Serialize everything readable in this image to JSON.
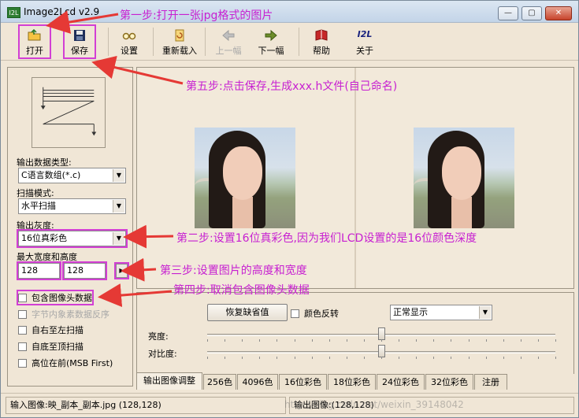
{
  "window": {
    "title": "Image2Lcd v2.9",
    "app_icon_text": "I2L"
  },
  "toolbar": {
    "items": [
      {
        "label": "打开",
        "icon": "folder-open-icon",
        "enabled": true
      },
      {
        "label": "保存",
        "icon": "floppy-disk-icon",
        "enabled": true
      },
      {
        "label": "设置",
        "icon": "glasses-icon",
        "enabled": true
      },
      {
        "label": "重新载入",
        "icon": "reload-icon",
        "enabled": true
      },
      {
        "label": "上一幅",
        "icon": "arrow-left-icon",
        "enabled": false
      },
      {
        "label": "下一幅",
        "icon": "arrow-right-icon",
        "enabled": true
      },
      {
        "label": "帮助",
        "icon": "help-book-icon",
        "enabled": true
      },
      {
        "label": "关于",
        "icon": "i2l-logo-icon",
        "enabled": true
      }
    ],
    "about_logo_text": "I2L"
  },
  "settings": {
    "output_type_label": "输出数据类型:",
    "output_type_value": "C语言数组(*.c)",
    "scan_mode_label": "扫描模式:",
    "scan_mode_value": "水平扫描",
    "gray_label": "输出灰度:",
    "gray_value": "16位真彩色",
    "size_label": "最大宽度和高度",
    "max_width": "128",
    "max_height": "128",
    "checkboxes": [
      {
        "label": "包含图像头数据",
        "checked": false,
        "enabled": true
      },
      {
        "label": "字节内象素数据反序",
        "checked": false,
        "enabled": false
      },
      {
        "label": "自右至左扫描",
        "checked": false,
        "enabled": true
      },
      {
        "label": "自底至顶扫描",
        "checked": false,
        "enabled": true
      },
      {
        "label": "高位在前(MSB First)",
        "checked": false,
        "enabled": true
      }
    ]
  },
  "adjust": {
    "restore_button": "恢复缺省值",
    "invert_label": "颜色反转",
    "display_mode": "正常显示",
    "brightness_label": "亮度:",
    "contrast_label": "对比度:",
    "brightness_level": 0.5,
    "contrast_level": 0.5
  },
  "tabs": [
    {
      "label": "输出图像调整",
      "active": true
    },
    {
      "label": "256色",
      "active": false
    },
    {
      "label": "4096色",
      "active": false
    },
    {
      "label": "16位彩色",
      "active": false
    },
    {
      "label": "18位彩色",
      "active": false
    },
    {
      "label": "24位彩色",
      "active": false
    },
    {
      "label": "32位彩色",
      "active": false
    },
    {
      "label": "注册",
      "active": false
    }
  ],
  "status": {
    "input": "输入图像:映_副本_副本.jpg (128,128)",
    "output": "输出图像:(128,128)"
  },
  "watermark": "http://blog.csdn.net/weixin_39148042",
  "annotations": {
    "step1": "第一步:打开一张jpg格式的图片",
    "step5": "第五步:点击保存,生成xxx.h文件(自己命名)",
    "step2": "第二步:设置16位真彩色,因为我们LCD设置的是16位颜色深度",
    "step3": "第三步:设置图片的高度和宽度",
    "step4": "第四步:取消包含图像头数据"
  },
  "colors": {
    "annotation": "#c71fd1",
    "arrow": "#e53935",
    "window_bg": "#f0e6d6"
  }
}
